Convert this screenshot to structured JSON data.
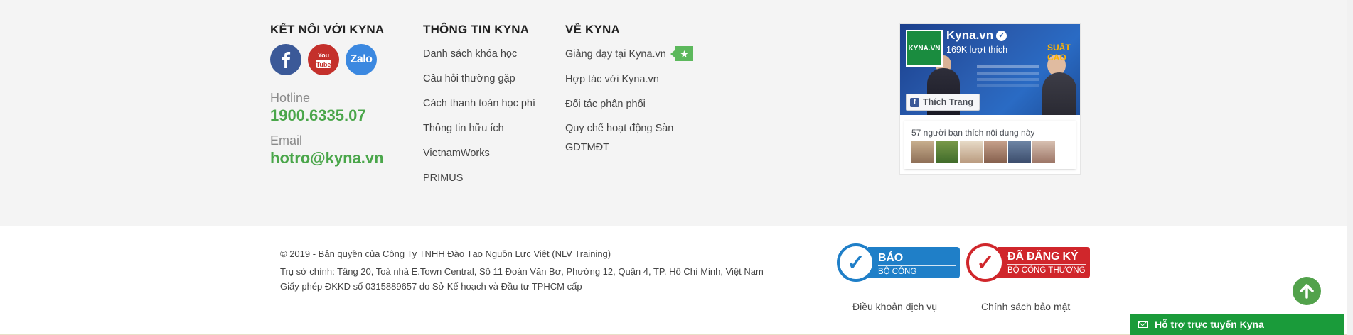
{
  "connect": {
    "title": "KẾT NỐI VỚI KYNA",
    "social": [
      {
        "icon": "facebook-icon",
        "label": "f"
      },
      {
        "icon": "youtube-icon",
        "label": "You Tube"
      },
      {
        "icon": "zalo-icon",
        "label": "Zalo"
      }
    ],
    "hotline_label": "Hotline",
    "hotline_value": "1900.6335.07",
    "email_label": "Email",
    "email_value": "hotro@kyna.vn"
  },
  "info": {
    "title": "THÔNG TIN KYNA",
    "links": [
      "Danh sách khóa học",
      "Câu hỏi thường gặp",
      "Cách thanh toán học phí",
      "Thông tin hữu ích",
      "VietnamWorks",
      "PRIMUS"
    ]
  },
  "about": {
    "title": "VỀ KYNA",
    "links": [
      "Giảng dạy tại Kyna.vn",
      "Hợp tác với Kyna.vn",
      "Đối tác phân phối",
      "Quy chế hoạt động Sàn GDTMĐT"
    ]
  },
  "facebook": {
    "page_name": "Kyna.vn",
    "likes": "169K lượt thích",
    "logo_text": "KYNA.VN",
    "cover_text": "SUẤT CAO",
    "like_button": "Thích Trang",
    "friends_text": "57 người bạn thích nội dung này"
  },
  "legal": {
    "copyright": "© 2019 - Bản quyền của Công Ty TNHH Đào Tạo Nguồn Lực Việt (NLV Training)",
    "address": "Trụ sở chính: Tầng 20, Toà nhà E.Town Central, Số 11 Đoàn Văn Bơ, Phường 12, Quận 4, TP. Hồ Chí Minh, Việt Nam",
    "license": "Giấy phép ĐKKD số 0315889657 do Sở Kế hoạch và Đầu tư TPHCM cấp"
  },
  "badges": {
    "notified_big": "ĐÃ THÔNG BÁO",
    "notified_small": "BỘ CÔNG THƯƠNG",
    "registered_big": "ĐÃ ĐĂNG KÝ",
    "registered_small": "BỘ CÔNG THƯƠNG"
  },
  "policies": {
    "terms": "Điều khoản dịch vụ",
    "privacy": "Chính sách bảo mật"
  },
  "support": {
    "label": "Hỗ trợ trực tuyến Kyna"
  },
  "colors": {
    "accent_green": "#4aa64a",
    "gov_blue": "#1f7fc8",
    "gov_red": "#d0262b",
    "support_green": "#1a9b3a"
  }
}
